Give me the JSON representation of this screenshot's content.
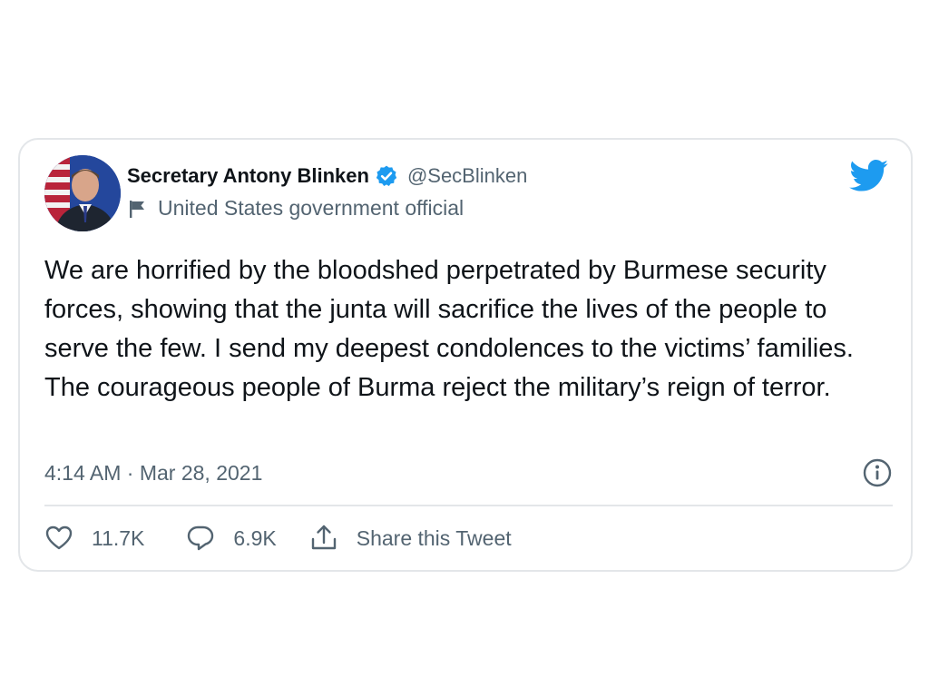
{
  "author": {
    "display_name": "Secretary Antony Blinken",
    "handle": "@SecBlinken",
    "label": "United States government official",
    "verified": true
  },
  "tweet": {
    "text": "We are horrified by the bloodshed perpetrated by Burmese security forces, showing that the junta will sacrifice the lives of the people to serve the few. I send my deepest condolences to the victims’ families. The courageous people of Burma reject the military’s reign of terror.",
    "timestamp": "4:14 AM · Mar 28, 2021"
  },
  "actions": {
    "likes": "11.7K",
    "replies": "6.9K",
    "share_label": "Share this Tweet"
  },
  "icons": {
    "brand": "twitter-bird-icon",
    "verified": "verified-badge-icon",
    "label": "government-flag-icon",
    "info": "info-icon",
    "like": "heart-icon",
    "reply": "reply-bubble-icon",
    "share": "share-icon"
  },
  "colors": {
    "brand_blue": "#1d9bf0",
    "text_primary": "#0f1419",
    "text_secondary": "#536471",
    "border": "#e3e6e9"
  }
}
